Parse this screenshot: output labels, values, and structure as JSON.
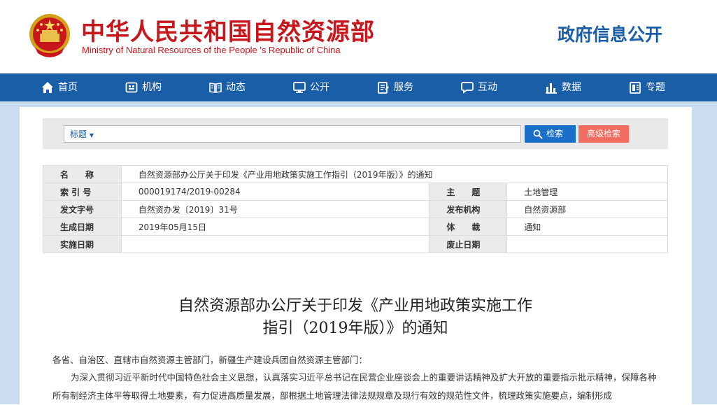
{
  "header": {
    "site_name_cn": "中华人民共和国自然资源部",
    "site_name_en": "Ministry of Natural Resources of the People 's Republic of China",
    "section_title": "政府信息公开"
  },
  "nav": {
    "items": [
      {
        "label": "首页",
        "icon": "home-icon"
      },
      {
        "label": "机构",
        "icon": "org-icon"
      },
      {
        "label": "动态",
        "icon": "news-icon"
      },
      {
        "label": "公开",
        "icon": "monitor-icon"
      },
      {
        "label": "服务",
        "icon": "service-icon"
      },
      {
        "label": "互动",
        "icon": "chat-icon"
      },
      {
        "label": "数据",
        "icon": "bar-chart-icon"
      },
      {
        "label": "专题",
        "icon": "topic-icon"
      }
    ]
  },
  "search": {
    "type_label": "标题",
    "type_arrow": "▼",
    "search_label": "检索",
    "advanced_label": "高级检索"
  },
  "info": {
    "name_label": "名　　称",
    "name_value": "自然资源部办公厅关于印发《产业用地政策实施工作指引（2019年版）》的通知",
    "index_label": "索 引 号",
    "index_value": "000019174/2019-00284",
    "subject_label": "主　　题",
    "subject_value": "土地管理",
    "doc_no_label": "发文字号",
    "doc_no_value": "自然资办发〔2019〕31号",
    "publisher_label": "发布机构",
    "publisher_value": "自然资源部",
    "date_label": "生成日期",
    "date_value": "2019年05月15日",
    "genre_label": "体　　裁",
    "genre_value": "通知",
    "effective_label": "实施日期",
    "effective_value": "",
    "expiry_label": "废止日期",
    "expiry_value": ""
  },
  "article": {
    "title_line1": "自然资源部办公厅关于印发《产业用地政策实施工作",
    "title_line2": "指引（2019年版）》的通知",
    "salutation": "各省、自治区、直辖市自然资源主管部门，新疆生产建设兵团自然资源主管部门：",
    "paragraph1": "为深入贯彻习近平新时代中国特色社会主义思想，认真落实习近平总书记在民营企业座谈会上的重要讲话精神及扩大开放的重要指示批示精神，保障各种所有制经济主体平等取得土地要素，有力促进高质量发展，部根据土地管理法律法规规章及现行有效的规范性文件，梳理政策实施要点，编制形成"
  },
  "colors": {
    "brand_red": "#c8161d",
    "nav_blue": "#1a5ea8",
    "search_blue": "#1a6fc9",
    "advanced_red": "#f16d61",
    "page_bg": "#c9dcf0"
  }
}
